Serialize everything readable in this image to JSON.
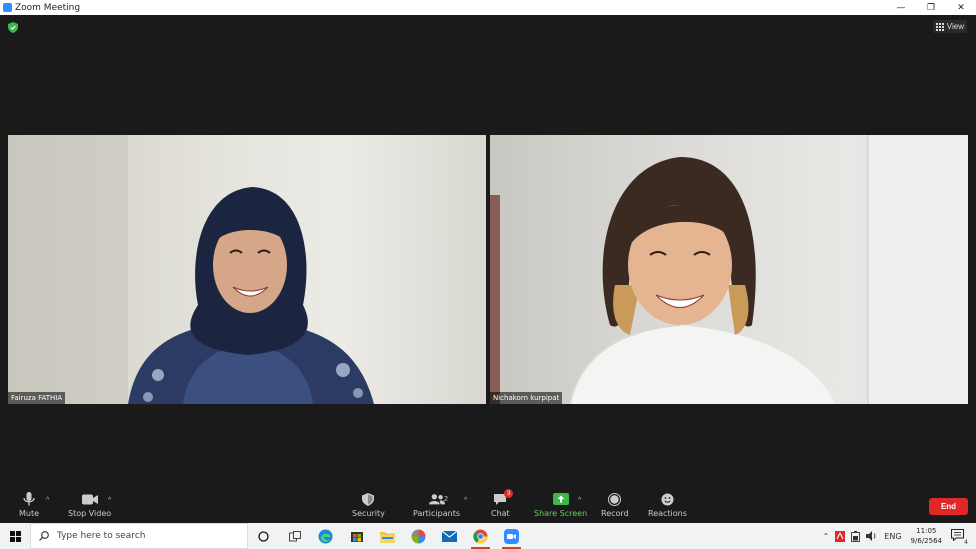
{
  "window": {
    "title": "Zoom Meeting",
    "controls": [
      "—",
      "❐",
      "✕"
    ]
  },
  "meeting": {
    "view_label": "View",
    "participants": [
      {
        "name": "Fairuza FATHIA"
      },
      {
        "name": "Nichakorn kurpipat"
      }
    ]
  },
  "toolbar": {
    "mute_label": "Mute",
    "stop_video_label": "Stop Video",
    "security_label": "Security",
    "participants_label": "Participants",
    "participants_count": "2",
    "chat_label": "Chat",
    "chat_badge": "3",
    "share_screen_label": "Share Screen",
    "record_label": "Record",
    "reactions_label": "Reactions",
    "end_label": "End"
  },
  "taskbar": {
    "search_placeholder": "Type here to search",
    "language": "ENG",
    "time": "11:05",
    "date": "9/6/2564",
    "notification_count": "4"
  },
  "colors": {
    "accent_green": "#5fd35f",
    "end_red": "#e02828",
    "background": "#1a1a1a"
  }
}
